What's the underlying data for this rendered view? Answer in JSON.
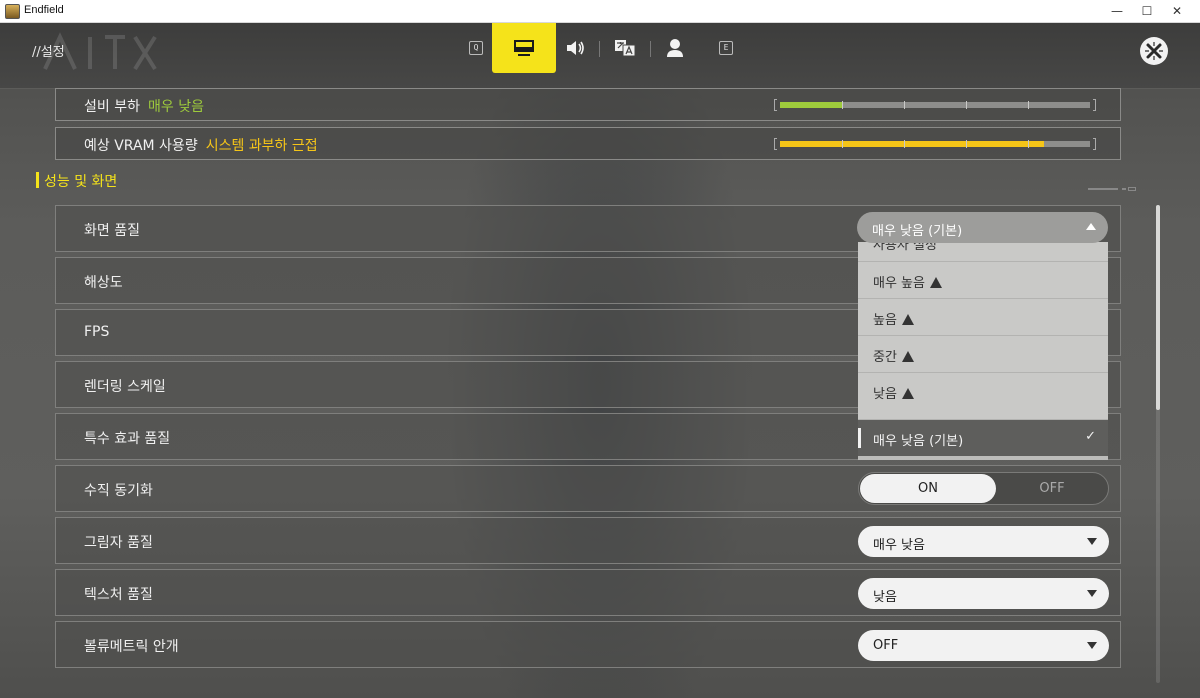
{
  "window": {
    "title": "Endfield",
    "minimize": "—",
    "maximize": "☐",
    "close": "✕"
  },
  "header": {
    "breadcrumb": "//설정",
    "tabs": [
      {
        "id": "prev",
        "key_hint": "Q"
      },
      {
        "id": "display",
        "active": true
      },
      {
        "id": "audio"
      },
      {
        "id": "language"
      },
      {
        "id": "account"
      },
      {
        "id": "next",
        "key_hint": "E"
      }
    ]
  },
  "load": {
    "device": {
      "label": "설비 부하",
      "value": "매우 낮음",
      "color": "#9ecb3c",
      "level": 0.2
    },
    "vram": {
      "label": "예상 VRAM 사용량",
      "value": "시스템 과부하 근접",
      "color": "#f5c518",
      "level": 0.85
    }
  },
  "section": {
    "title": "성능 및 화면"
  },
  "settings": [
    {
      "label": "화면 품질",
      "control": "dropdown-open",
      "value": "매우 낮음 (기본)"
    },
    {
      "label": "해상도",
      "control": "hidden"
    },
    {
      "label": "FPS",
      "control": "hidden"
    },
    {
      "label": "렌더링 스케일",
      "control": "hidden"
    },
    {
      "label": "특수 효과 품질",
      "control": "hidden"
    },
    {
      "label": "수직 동기화",
      "control": "toggle",
      "on": "ON",
      "off": "OFF",
      "value": "ON"
    },
    {
      "label": "그림자 품질",
      "control": "dropdown",
      "value": "매우 낮음"
    },
    {
      "label": "텍스처 품질",
      "control": "dropdown",
      "value": "낮음"
    },
    {
      "label": "볼류메트릭 안개",
      "control": "dropdown",
      "value": "OFF"
    }
  ],
  "quality_dropdown": {
    "options": [
      {
        "label": "사용자 설정",
        "warning": false
      },
      {
        "label": "매우 높음",
        "warning": true
      },
      {
        "label": "높음",
        "warning": true
      },
      {
        "label": "중간",
        "warning": true
      },
      {
        "label": "낮음",
        "warning": true
      },
      {
        "label": "매우 낮음 (기본)",
        "warning": false,
        "selected": true
      }
    ],
    "check": "✓"
  },
  "scroll": {
    "position": 0.0,
    "visible_fraction": 0.43
  }
}
